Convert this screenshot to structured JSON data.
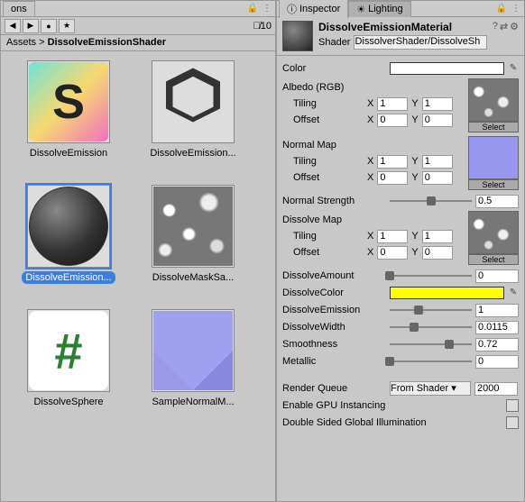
{
  "left": {
    "tab_label": "ons",
    "hidden_count": "10",
    "breadcrumb_root": "Assets",
    "breadcrumb_sep": " > ",
    "breadcrumb_current": "DissolveEmissionShader",
    "assets": [
      {
        "name": "DissolveEmission",
        "kind": "s"
      },
      {
        "name": "DissolveEmission...",
        "kind": "unity"
      },
      {
        "name": "DissolveEmission...",
        "kind": "sphere",
        "selected": true
      },
      {
        "name": "DissolveMaskSa...",
        "kind": "noise"
      },
      {
        "name": "DissolveSphere",
        "kind": "hash"
      },
      {
        "name": "SampleNormalM...",
        "kind": "normal"
      }
    ]
  },
  "right": {
    "tab_inspector": "Inspector",
    "tab_lighting": "Lighting",
    "material_name": "DissolveEmissionMaterial",
    "shader_label": "Shader",
    "shader_value": "DissolverShader/DissolveSh",
    "color_label": "Color",
    "color_value": "#ffffff",
    "albedo": {
      "label": "Albedo (RGB)",
      "tiling_label": "Tiling",
      "tiling_x": "1",
      "tiling_y": "1",
      "offset_label": "Offset",
      "offset_x": "0",
      "offset_y": "0",
      "select": "Select"
    },
    "normalmap": {
      "label": "Normal Map",
      "tiling_label": "Tiling",
      "tiling_x": "1",
      "tiling_y": "1",
      "offset_label": "Offset",
      "offset_x": "0",
      "offset_y": "0",
      "select": "Select"
    },
    "normal_strength": {
      "label": "Normal Strength",
      "value": "0.5",
      "pct": 50
    },
    "dissolvemap": {
      "label": "Dissolve Map",
      "tiling_label": "Tiling",
      "tiling_x": "1",
      "tiling_y": "1",
      "offset_label": "Offset",
      "offset_x": "0",
      "offset_y": "0",
      "select": "Select"
    },
    "dissolve_amount": {
      "label": "DissolveAmount",
      "value": "0",
      "pct": 0
    },
    "dissolve_color": {
      "label": "DissolveColor",
      "value": "#ffff00"
    },
    "dissolve_emission": {
      "label": "DissolveEmission",
      "value": "1",
      "pct": 35
    },
    "dissolve_width": {
      "label": "DissolveWidth",
      "value": "0.0115",
      "pct": 30
    },
    "smoothness": {
      "label": "Smoothness",
      "value": "0.72",
      "pct": 72
    },
    "metallic": {
      "label": "Metallic",
      "value": "0",
      "pct": 0
    },
    "render_queue": {
      "label": "Render Queue",
      "option": "From Shader",
      "value": "2000"
    },
    "gpu_instancing": "Enable GPU Instancing",
    "double_sided": "Double Sided Global Illumination",
    "x_label": "X",
    "y_label": "Y"
  }
}
